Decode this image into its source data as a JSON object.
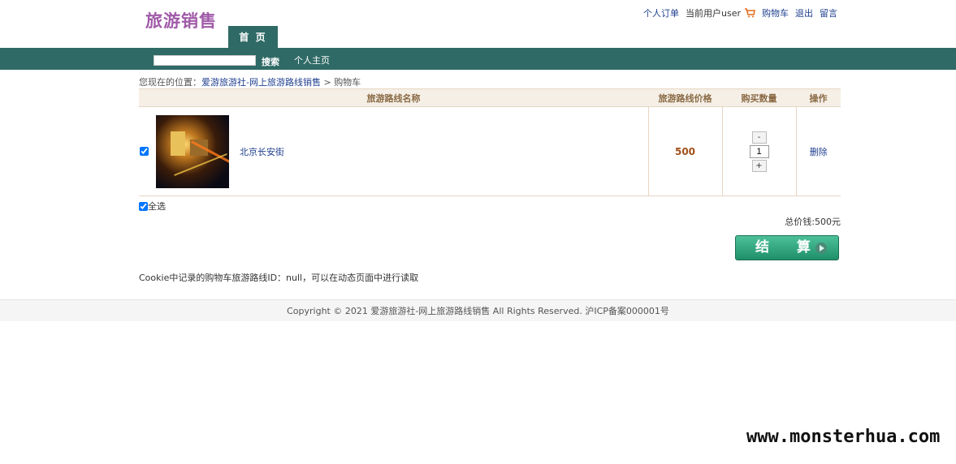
{
  "header": {
    "logo": "旅游销售",
    "links": {
      "orders": "个人订单",
      "current_user": "当前用户user",
      "cart": "购物车",
      "logout": "退出",
      "message": "留言"
    },
    "home_tab": "首 页"
  },
  "nav": {
    "search_value": "",
    "search_button": "搜索",
    "home_page": "个人主页"
  },
  "breadcrumb": {
    "prefix": "您现在的位置：",
    "site": "爱游旅游社-网上旅游路线销售",
    "separator": " > ",
    "current": "购物车"
  },
  "cart": {
    "headers": {
      "name": "旅游路线名称",
      "price": "旅游路线价格",
      "qty": "购买数量",
      "op": "操作"
    },
    "items": [
      {
        "name": "北京长安街",
        "price": "500",
        "qty": "1",
        "minus": "-",
        "plus": "+",
        "delete": "删除",
        "checked": true
      }
    ],
    "select_all": "全选",
    "total": "总价钱:500元",
    "checkout": "结 算"
  },
  "cookie_note": "Cookie中记录的购物车旅游路线ID：null，可以在动态页面中进行读取",
  "footer": "Copyright © 2021 爱游旅游社-网上旅游路线销售 All Rights Reserved. 沪ICP备案000001号",
  "watermark": "www.monsterhua.com",
  "colors": {
    "nav": "#2f6a66",
    "logo": "#a05aa8",
    "link": "#1f3f8f",
    "price": "#a0501a",
    "checkout": "#1f8f6a"
  }
}
